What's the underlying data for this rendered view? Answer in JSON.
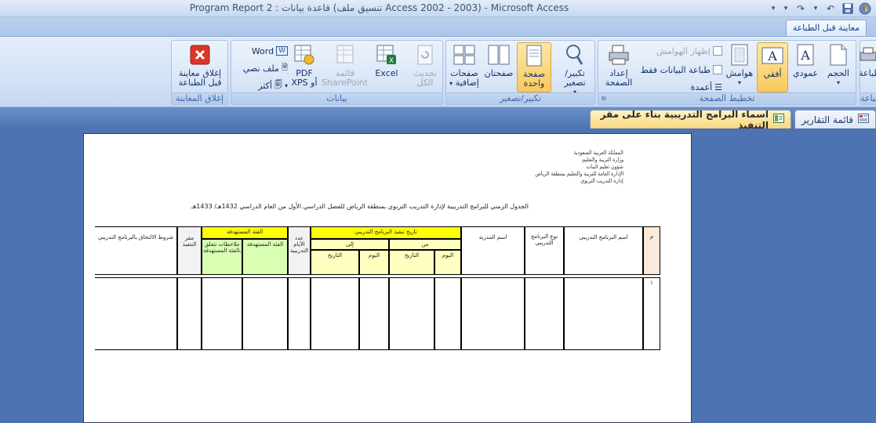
{
  "window": {
    "title": "Program Report 2 : قاعدة بيانات (تنسيق ملف Access 2002 - 2003) - Microsoft Access"
  },
  "ribbon": {
    "active_tab": "معاينة قبل الطباعة",
    "groups": {
      "print_label": "طباعة",
      "layout_label": "تخطيط الصفحة",
      "zoom_label": "تكبير/تصغير",
      "data_label": "بيانات",
      "close_label": "إغلاق المعاينة"
    },
    "buttons": {
      "print": "طباعة",
      "size": "الحجم",
      "portrait": "عمودي",
      "landscape": "أفقي",
      "margins": "هوامش",
      "show_margins": "إظهار الهوامش",
      "print_data_only": "طباعة البيانات فقط",
      "columns": "أعمدة",
      "page_setup_1": "إعداد",
      "page_setup_2": "الصفحة",
      "zoom": "تكبير/تصغير",
      "one_page_1": "صفحة",
      "one_page_2": "واحدة",
      "two_pages": "صفحتان",
      "more_pages_1": "صفحات",
      "more_pages_2": "إضافية",
      "refresh_1": "تحديث",
      "refresh_2": "الكل",
      "excel": "Excel",
      "sharepoint_1": "قائمة",
      "sharepoint_2": "SharePoint",
      "pdf_1": "PDF",
      "pdf_2": "أو XPS",
      "word": "Word",
      "text_file": "ملف نصي",
      "more": "أكثر",
      "close_preview_1": "إغلاق معاينة",
      "close_preview_2": "قبل الطباعة"
    }
  },
  "doc_tabs": {
    "reports_list": "قائمة التقارير",
    "active_report": "اسماء البرامج التدريبية بناء على مقر التنفيذ"
  },
  "report": {
    "header_lines": [
      "المملكة العربية السعودية",
      "وزارة التربية والتعليم",
      "شؤون تعليم البنات",
      "الإدارة العامة للتربية والتعليم بمنطقة الرياض",
      "إدارة التدريب التربوي"
    ],
    "title": "الجدول الزمني للبرامج التدريبية لإدارة التدريب التربوي بمنطقة الرياض للفصل الدراسي الأول من العام الدراسي 1432هـ/ 1433هـ",
    "columns": {
      "num": "م",
      "program_name": "اسم البرنامج التدريبي",
      "program_type": "نوع البرنامج التدريبي",
      "trainer": "اسم المدربة",
      "exec_date": "تاريخ تنفيذ البرنامج التدريبي",
      "from": "من",
      "to": "إلى",
      "day": "اليوم",
      "date": "التاريخ",
      "days_count": "عدد الأيام التدريبية",
      "target_group": "الفئة المستهدفة",
      "target_group_sub": "الفئة المستهدفة",
      "target_notes": "ملاحظات تتعلق بالفئة المستهدفة",
      "venue": "مقر التنفيذ",
      "conditions": "شروط الالتحاق بالبرنامج التدريبي"
    },
    "row_num": "١"
  }
}
